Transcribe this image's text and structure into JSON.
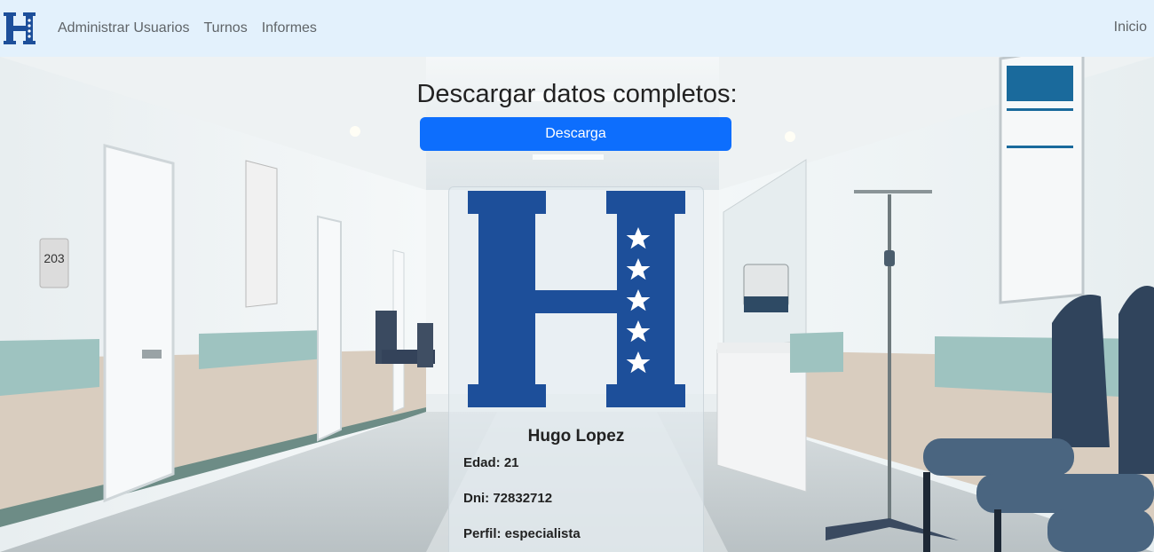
{
  "colors": {
    "navbar_bg": "#e3f1fc",
    "brand_blue": "#1d4f9a",
    "primary_button": "#0d6efd"
  },
  "navbar": {
    "logo_icon": "honduras-h-logo-icon",
    "links": [
      "Administrar Usuarios",
      "Turnos",
      "Informes"
    ],
    "right_link": "Inicio"
  },
  "download": {
    "title": "Descargar datos completos:",
    "button_label": "Descarga"
  },
  "profile": {
    "logo_icon": "honduras-h-logo-icon",
    "name": "Hugo Lopez",
    "age": "Edad: 21",
    "dni": "Dni: 72832712",
    "profile_type": "Perfil: especialista"
  },
  "background": {
    "sign_text": "203"
  }
}
